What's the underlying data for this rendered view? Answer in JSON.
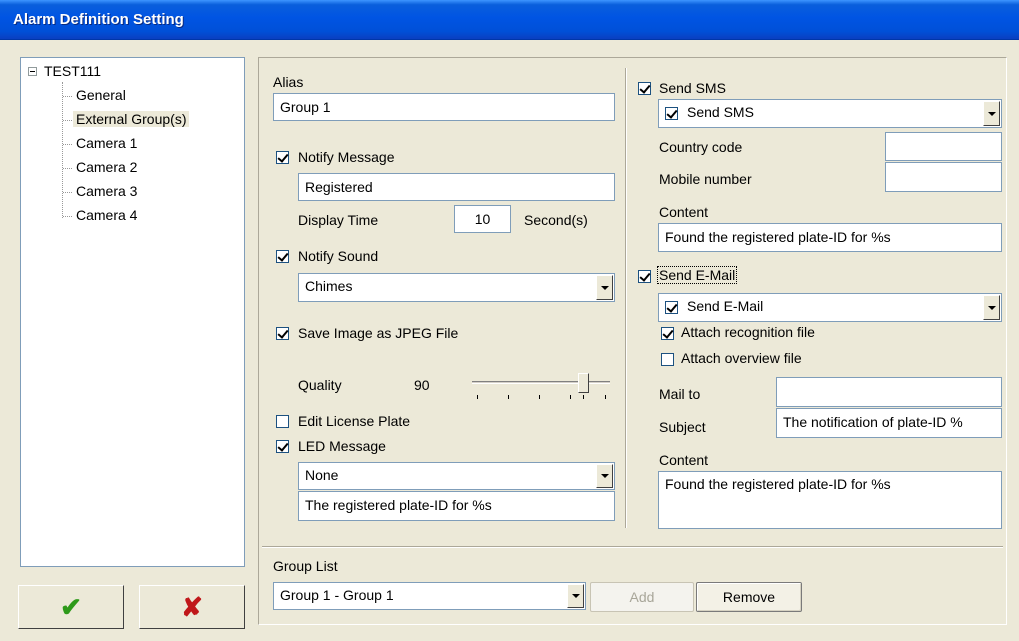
{
  "window": {
    "title": "Alarm Definition Setting"
  },
  "tree": {
    "root": "TEST111",
    "items": [
      "General",
      "External Group(s)",
      "Camera 1",
      "Camera 2",
      "Camera 3",
      "Camera 4"
    ],
    "selected": "External Group(s)"
  },
  "actions": {
    "ok_glyph": "✔",
    "cancel_glyph": "✘",
    "ok_color": "#2e9a1a",
    "cancel_color": "#c0171a"
  },
  "left": {
    "alias_label": "Alias",
    "alias_value": "Group 1",
    "notify_message": {
      "label": "Notify Message",
      "checked": true,
      "value": "Registered"
    },
    "display_time": {
      "label": "Display Time",
      "value": "10",
      "unit": "Second(s)"
    },
    "notify_sound": {
      "label": "Notify Sound",
      "checked": true,
      "selected": "Chimes"
    },
    "save_image": {
      "label": "Save Image as JPEG File",
      "checked": true
    },
    "quality": {
      "label": "Quality",
      "value": "90"
    },
    "edit_plate": {
      "label": "Edit License Plate",
      "checked": false
    },
    "led_message": {
      "label": "LED Message",
      "checked": true,
      "selected": "None",
      "text": "The registered plate-ID for %s"
    }
  },
  "right": {
    "send_sms": {
      "label": "Send SMS",
      "checked": true,
      "combo_label": "Send SMS",
      "country_code_label": "Country code",
      "country_code_value": "",
      "mobile_label": "Mobile number",
      "mobile_value": "",
      "content_label": "Content",
      "content_value": "Found the registered plate-ID for %s"
    },
    "send_email": {
      "label": "Send E-Mail",
      "checked": true,
      "combo_label": "Send E-Mail",
      "attach_recognition": {
        "label": "Attach recognition file",
        "checked": true
      },
      "attach_overview": {
        "label": "Attach overview file",
        "checked": false
      },
      "mail_to_label": "Mail to",
      "mail_to_value": "",
      "subject_label": "Subject",
      "subject_value": "The notification of plate-ID %",
      "content_label": "Content",
      "content_value": "Found the registered plate-ID for %s"
    }
  },
  "bottom": {
    "group_list_label": "Group List",
    "group_list_selected": "Group 1 - Group 1",
    "add_label": "Add",
    "remove_label": "Remove"
  }
}
